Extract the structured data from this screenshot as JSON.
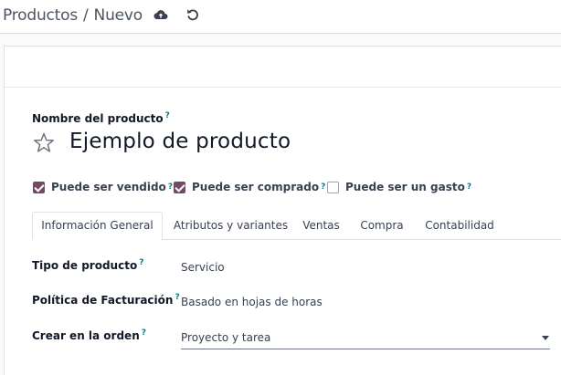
{
  "breadcrumb": {
    "parent": "Productos",
    "separator": "/",
    "current": "Nuevo"
  },
  "toolbar": {
    "save_icon": "cloud-upload-icon",
    "discard_icon": "undo-icon"
  },
  "form": {
    "name_label": "Nombre del producto",
    "name_help": "?",
    "name_value": "Ejemplo de producto",
    "favorite_icon": "star-outline-icon",
    "checkboxes": [
      {
        "label": "Puede ser vendido",
        "checked": true,
        "help": "?"
      },
      {
        "label": "Puede ser comprado",
        "checked": true,
        "help": "?"
      },
      {
        "label": "Puede ser un gasto",
        "checked": false,
        "help": "?"
      }
    ],
    "tabs": [
      {
        "label": "Información General",
        "active": true
      },
      {
        "label": "Atributos y variantes",
        "active": false
      },
      {
        "label": "Ventas",
        "active": false
      },
      {
        "label": "Compra",
        "active": false
      },
      {
        "label": "Contabilidad",
        "active": false
      }
    ],
    "fields": [
      {
        "label": "Tipo de producto",
        "help": "?",
        "value": "Servicio"
      },
      {
        "label": "Política de Facturación",
        "help": "?",
        "value": "Basado en hojas de horas"
      },
      {
        "label": "Crear en la orden",
        "help": "?",
        "value": "Proyecto y tarea"
      }
    ]
  },
  "colors": {
    "accent": "#714b67",
    "help": "#017e84",
    "background": "#f9fafb"
  }
}
